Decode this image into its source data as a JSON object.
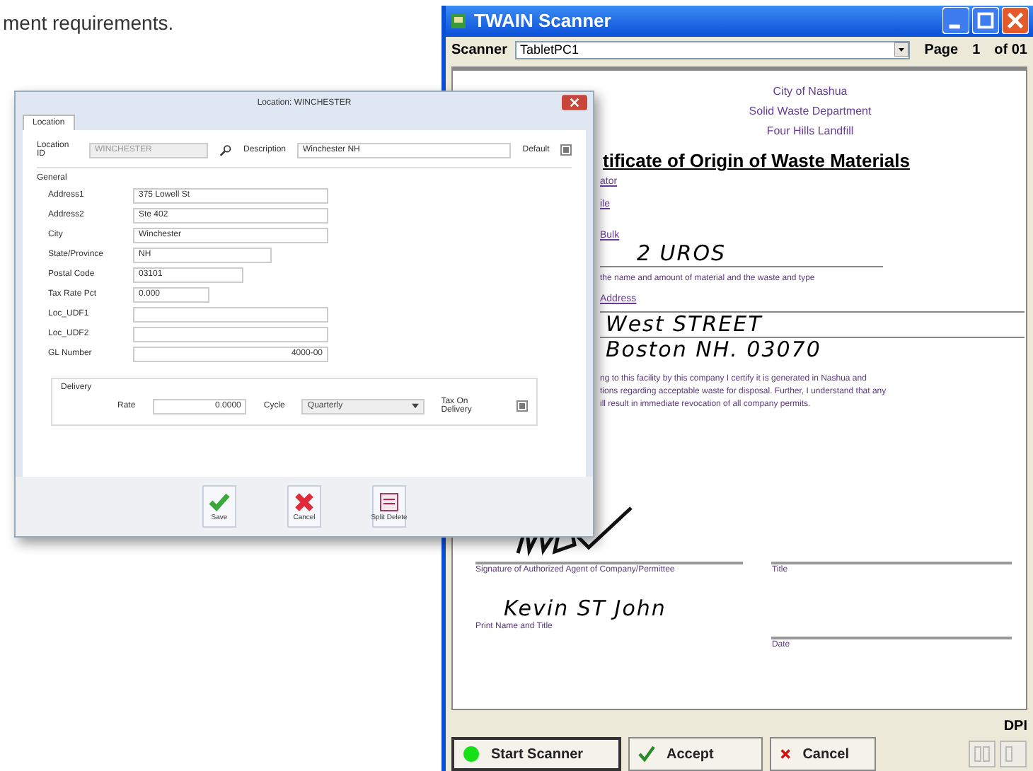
{
  "page_text": "ment requirements.",
  "scanner": {
    "title": "TWAIN Scanner",
    "scanner_label": "Scanner",
    "device": "TabletPC1",
    "page_label": "Page",
    "page": "1",
    "page_of": "of 01",
    "document": {
      "header": [
        "City of Nashua",
        "Solid Waste Department",
        "Four Hills Landfill"
      ],
      "title": "tificate of Origin of Waste Materials",
      "side_labels": [
        "ator",
        "ile"
      ],
      "bulk_label": "Bulk",
      "bulk_value": "2 UROS",
      "material_note": "the name and amount of material and the waste and type",
      "address_label": "Address",
      "address_lines": [
        "West STREET",
        "Boston NH. 03070"
      ],
      "statement": [
        "ng to this facility by this company I certify it is generated in Nashua and",
        "tions regarding acceptable waste for disposal. Further, I understand that any",
        "ill result in immediate revocation of all company permits."
      ],
      "signature_label": "Signature of Authorized Agent of Company/Permittee",
      "title_label": "Title",
      "print_name": "Kevin ST John",
      "print_label": "Print Name and Title",
      "date_label": "Date"
    },
    "dpi_label": "DPI",
    "buttons": [
      {
        "label": "Start Scanner",
        "kind": "start"
      },
      {
        "label": "Accept",
        "kind": "accept"
      },
      {
        "label": "Cancel",
        "kind": "cancel"
      }
    ]
  },
  "location_window": {
    "title": "Location: WINCHESTER",
    "tabs": [
      {
        "label": "Location",
        "selected": true
      }
    ],
    "location_id": {
      "label": "Location ID",
      "value": "WINCHESTER"
    },
    "description": {
      "label": "Description",
      "value": "Winchester NH"
    },
    "default": {
      "label": "Default",
      "checked": true
    },
    "group": "General",
    "fields": [
      {
        "label": "Address1",
        "value": "375 Lowell St",
        "kind": "text"
      },
      {
        "label": "Address2",
        "value": "Ste 402",
        "kind": "text"
      },
      {
        "label": "City",
        "value": "Winchester",
        "kind": "text"
      },
      {
        "label": "State/Province",
        "value": "NH",
        "kind": "text"
      },
      {
        "label": "Postal Code",
        "value": "03101",
        "kind": "text"
      },
      {
        "label": "Tax Rate Pct",
        "value": "0.000",
        "kind": "text"
      },
      {
        "label": "Loc_UDF1",
        "kind": "text"
      },
      {
        "label": "Loc_UDF2",
        "kind": "text"
      },
      {
        "label": "GL Number",
        "value": "4000-00",
        "kind": "number"
      }
    ],
    "delivery": {
      "label": "Delivery",
      "rate_label": "Rate",
      "rate": "0.0000",
      "cycle_label": "Cycle",
      "cycle": "Quarterly",
      "tax_label": "Tax On Delivery",
      "tax_checked": true
    },
    "buttons": [
      {
        "label": "Save",
        "kind": "save"
      },
      {
        "label": "Cancel",
        "kind": "cancel"
      },
      {
        "label": "Split Delete",
        "kind": "split"
      }
    ]
  }
}
